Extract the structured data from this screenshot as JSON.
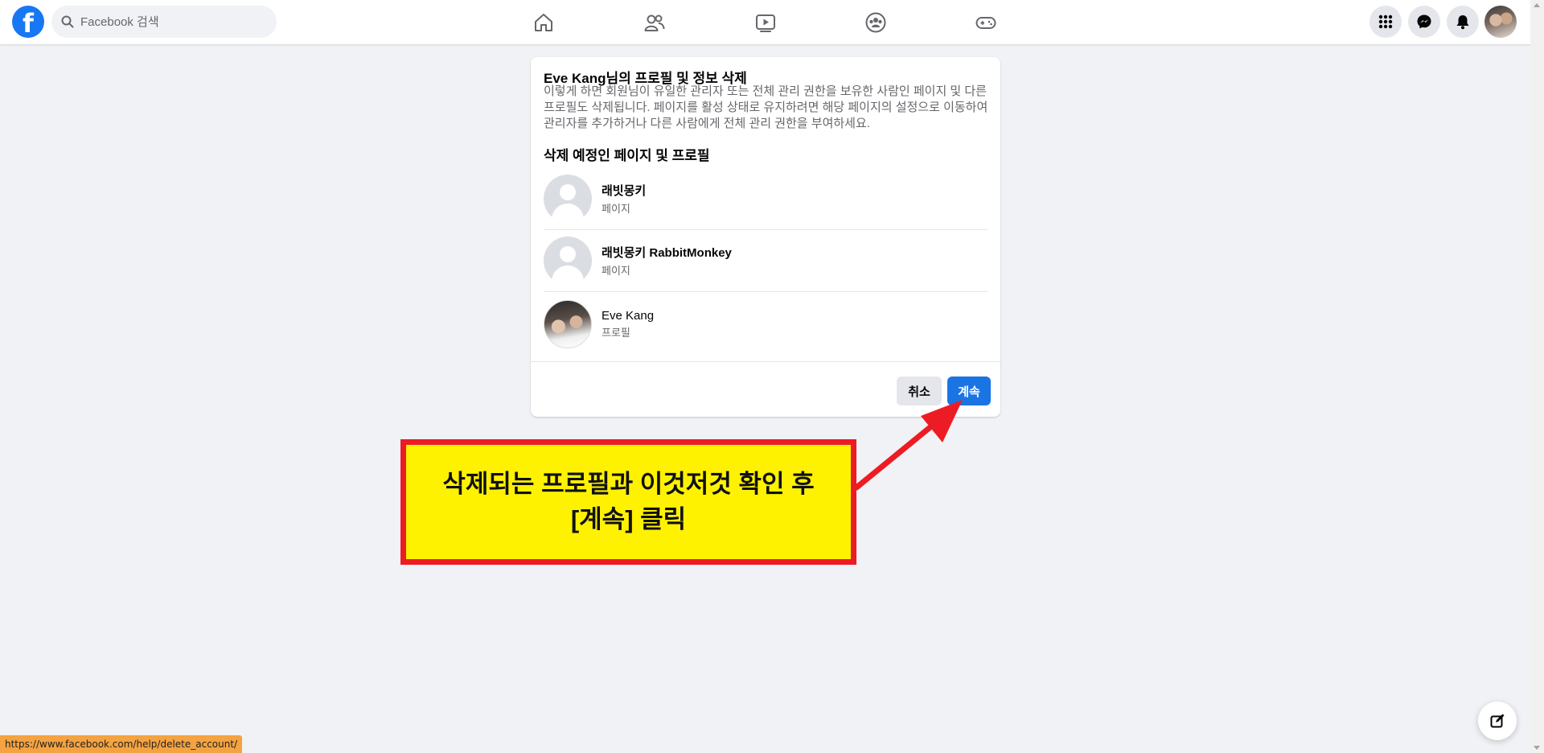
{
  "header": {
    "logo_letter": "f",
    "search_placeholder": "Facebook 검색",
    "nav_icons": [
      "home-icon",
      "friends-icon",
      "watch-icon",
      "groups-icon",
      "gaming-icon"
    ],
    "right_icons": [
      "menu-grid-icon",
      "messenger-icon",
      "notifications-icon",
      "profile-avatar"
    ]
  },
  "dialog": {
    "title": "Eve Kang님의 프로필 및 정보 삭제",
    "description": "이렇게 하면 회원님이 유일한 관리자 또는 전체 관리 권한을 보유한 사람인 페이지 및 다른 프로필도 삭제됩니다. 페이지를 활성 상태로 유지하려면 해당 페이지의 설정으로 이동하여 관리자를 추가하거나 다른 사람에게 전체 관리 권한을 부여하세요.",
    "section_title": "삭제 예정인 페이지 및 프로필",
    "items": [
      {
        "name": "래빗몽키",
        "type": "페이지"
      },
      {
        "name": "래빗몽키 RabbitMonkey",
        "type": "페이지"
      },
      {
        "name": "Eve Kang",
        "type": "프로필"
      }
    ],
    "cancel_label": "취소",
    "continue_label": "계속"
  },
  "annotation": {
    "line1": "삭제되는 프로필과 이것저것 확인 후",
    "line2": "[계속] 클릭",
    "box_color": "#fff200",
    "border_color": "#ed1c24"
  },
  "status_bar": {
    "url": "https://www.facebook.com/help/delete_account/"
  },
  "colors": {
    "brand": "#1877f2",
    "primary_button": "#1b74e4",
    "page_bg": "#f0f2f5"
  }
}
